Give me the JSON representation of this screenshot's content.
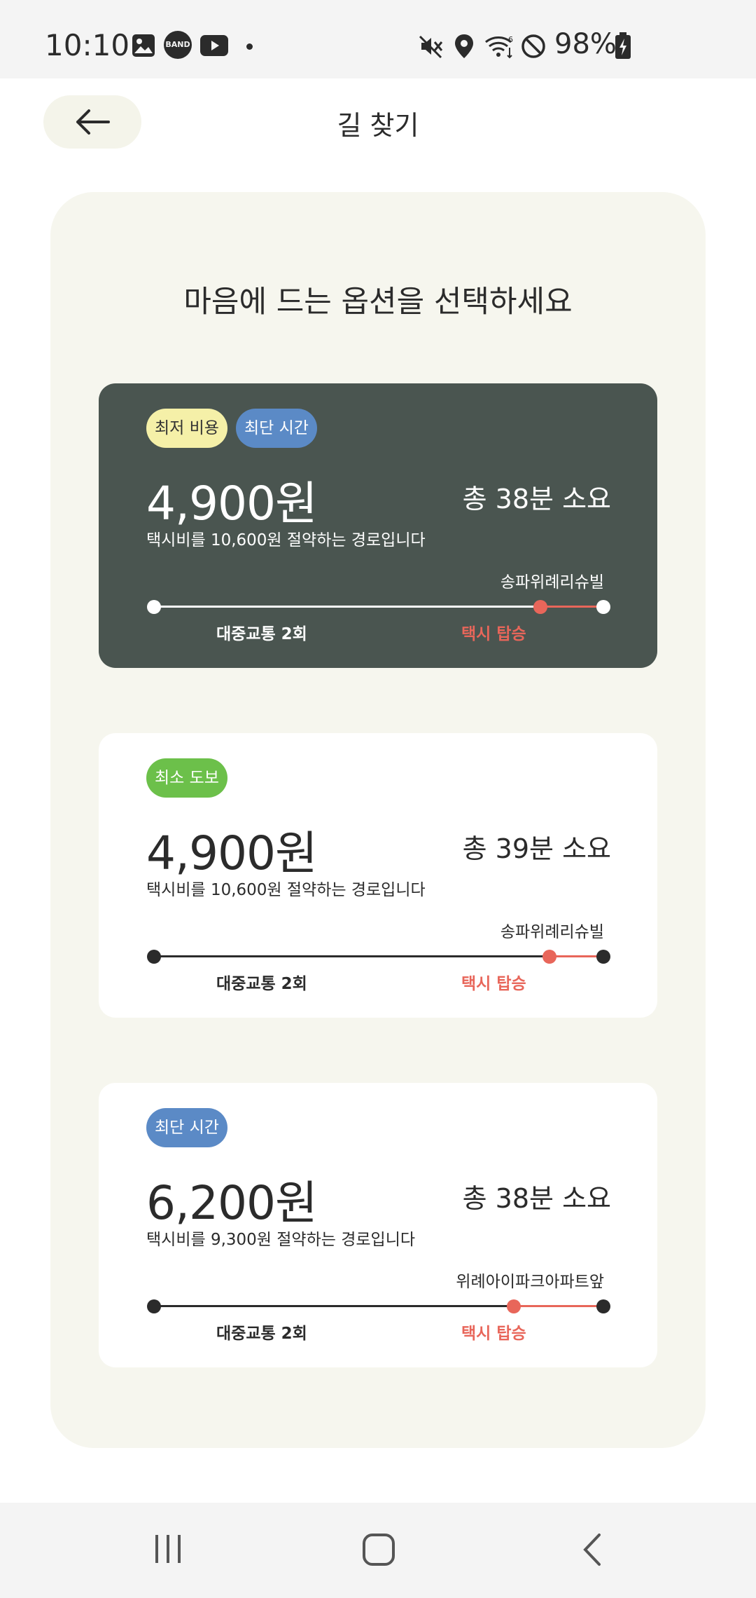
{
  "status_bar": {
    "time": "10:10",
    "left_icons": [
      "gallery-icon",
      "band-icon",
      "youtube-icon",
      "dot-icon"
    ],
    "band_text": "BAND",
    "right_icons": [
      "mute-icon",
      "location-icon",
      "wifi-icon",
      "do-not-disturb-icon",
      "battery-charging-icon"
    ],
    "battery": "98%"
  },
  "header": {
    "back_icon": "arrow-left-icon",
    "title": "길 찾기"
  },
  "panel": {
    "title": "마음에 드는 옵션을 선택하세요"
  },
  "colors": {
    "selected_card": "#4a5550",
    "badge_lowest_cost": "#f5f0a8",
    "badge_shortest_time": "#5b8ac6",
    "badge_least_walk": "#6cc04a",
    "taxi": "#e8665a",
    "panel_bg": "#f6f6ee"
  },
  "routes": [
    {
      "selected": true,
      "badges": [
        {
          "label": "최저 비용",
          "color": "#f5f0a8",
          "text_color": "#333333"
        },
        {
          "label": "최단 시간",
          "color": "#5b8ac6",
          "text_color": "#ffffff"
        }
      ],
      "price": "4,900원",
      "duration": "총 38분 소요",
      "savings_text": "택시비를 10,600원 절약하는 경로입니다",
      "transfer_stop": "송파위례리슈빌",
      "transit_label": "대중교통 2회",
      "taxi_label": "택시 탑승",
      "taxi_fraction": 0.14
    },
    {
      "selected": false,
      "badges": [
        {
          "label": "최소 도보",
          "color": "#6cc04a",
          "text_color": "#ffffff"
        }
      ],
      "price": "4,900원",
      "duration": "총 39분 소요",
      "savings_text": "택시비를 10,600원 절약하는 경로입니다",
      "transfer_stop": "송파위례리슈빌",
      "transit_label": "대중교통 2회",
      "taxi_label": "택시 탑승",
      "taxi_fraction": 0.12
    },
    {
      "selected": false,
      "badges": [
        {
          "label": "최단 시간",
          "color": "#5b8ac6",
          "text_color": "#ffffff"
        }
      ],
      "price": "6,200원",
      "duration": "총 38분 소요",
      "savings_text": "택시비를 9,300원 절약하는 경로입니다",
      "transfer_stop": "위례아이파크아파트앞",
      "transit_label": "대중교통 2회",
      "taxi_label": "택시 탑승",
      "taxi_fraction": 0.2
    }
  ],
  "nav_bar": {
    "items": [
      "recent-apps-icon",
      "home-icon",
      "back-icon"
    ]
  }
}
